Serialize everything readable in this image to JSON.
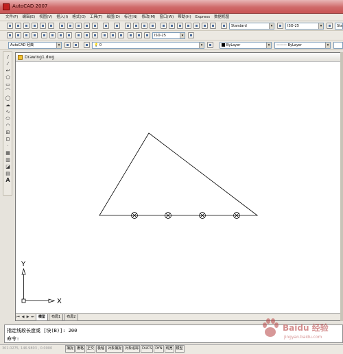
{
  "window": {
    "title": "AutoCAD 2007"
  },
  "menu": [
    "文件(F)",
    "编辑(E)",
    "视图(V)",
    "插入(I)",
    "格式(O)",
    "工具(T)",
    "绘图(D)",
    "标注(N)",
    "修改(M)",
    "窗口(W)",
    "帮助(H)",
    "Express",
    "数据视图"
  ],
  "toolbar": {
    "text_style": "Standard",
    "dim_style": "ISO-25",
    "table_style": "Standard",
    "dim_style_2": "ISO-25",
    "workspace": "AutoCAD 经典",
    "layer": "0",
    "color": "ByLayer",
    "linetype": "ByLayer"
  },
  "document": {
    "title": "Drawing1.dwg",
    "ucs_labels": {
      "y": "Y",
      "x": "X"
    },
    "tabs": [
      "模型",
      "布局1",
      "布局2"
    ]
  },
  "command": {
    "history": "指定线段长度或 [块(B)]: 200",
    "prompt": "命令:"
  },
  "status": {
    "coords": "301.0275, 146.9803 , 0.0000",
    "buttons": [
      "捕捉",
      "栅格",
      "正交",
      "极轴",
      "对象捕捉",
      "对象追踪",
      "DUCS",
      "DYN",
      "线宽",
      "模型"
    ]
  },
  "watermark": {
    "text": "Baidu 经验",
    "url": "jingyan.baidu.com"
  },
  "colors": {
    "titlebar": "#c85555",
    "chrome": "#ece9e2",
    "canvas": "#ffffff"
  }
}
